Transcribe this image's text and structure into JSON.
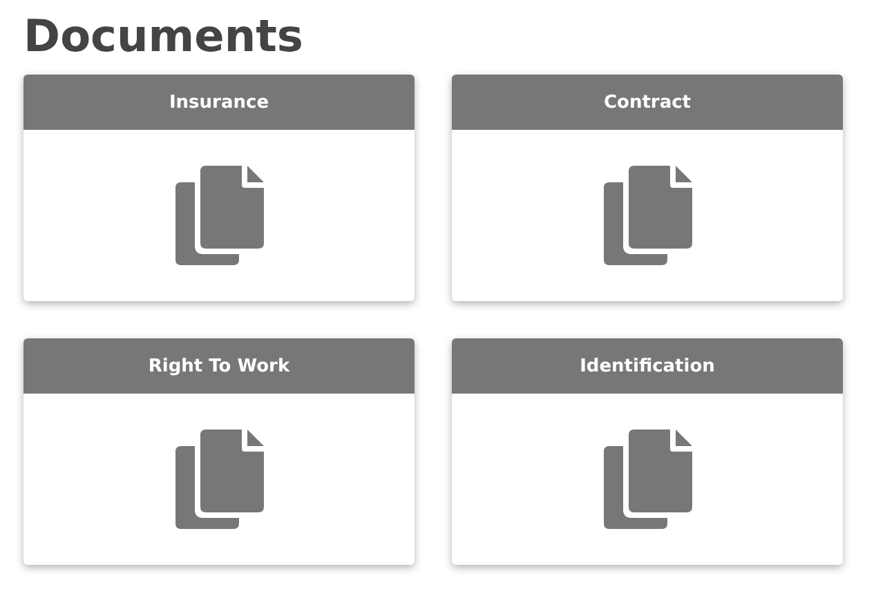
{
  "title": "Documents",
  "documents": [
    {
      "label": "Insurance"
    },
    {
      "label": "Contract"
    },
    {
      "label": "Right To Work"
    },
    {
      "label": "Identification"
    }
  ]
}
